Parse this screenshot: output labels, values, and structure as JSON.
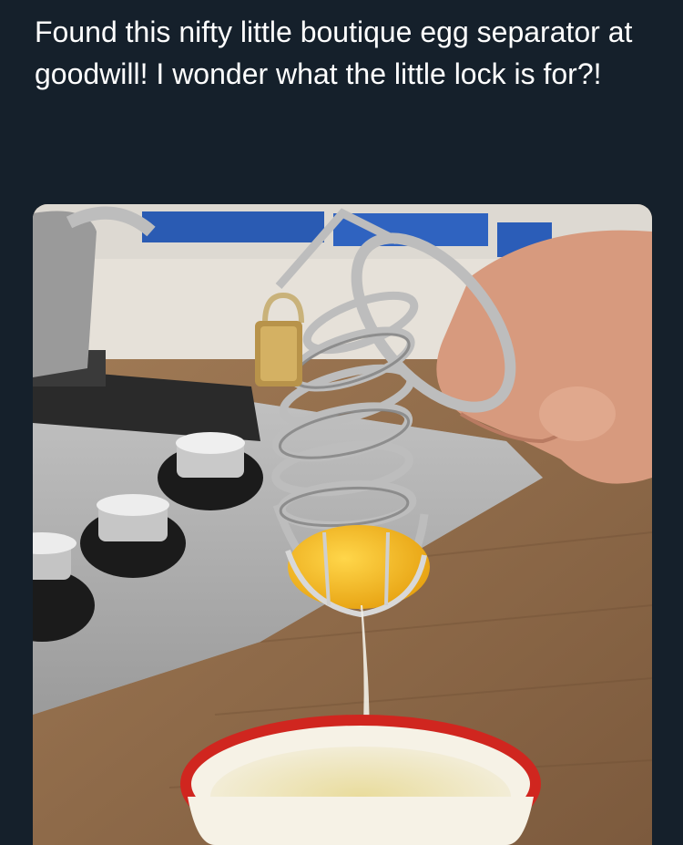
{
  "post": {
    "text": "Found this nifty little boutique egg separator at goodwill! I wonder what the little lock is for?!"
  },
  "photo": {
    "subject": "metal coil cage with padlock holding egg yolk over bowl"
  },
  "colors": {
    "background": "#15202b",
    "text": "#ffffff",
    "yolk": "#f2b81c",
    "bowl_rim": "#d0261f",
    "countertop": "#8a6a4c"
  }
}
